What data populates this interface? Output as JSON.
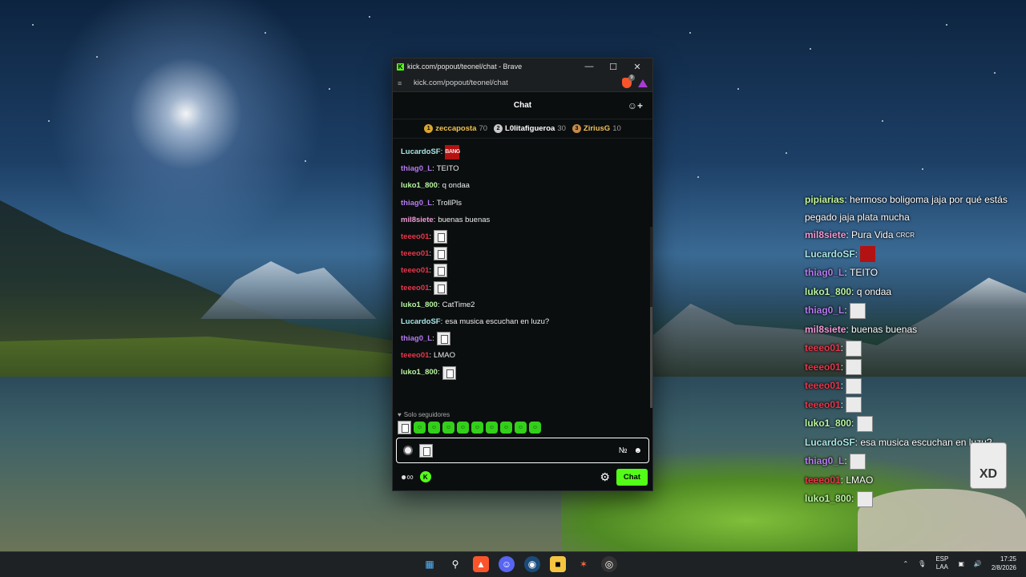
{
  "browser": {
    "title": "kick.com/popout/teonel/chat - Brave",
    "url": "kick.com/popout/teonel/chat",
    "logo_letter": "K",
    "shields_count": "9"
  },
  "chat": {
    "header": "Chat",
    "leaderboard": [
      {
        "rank": "1",
        "name": "zeccaposta",
        "count": "70",
        "color": "#f2c14e",
        "medal": "#d9a62e"
      },
      {
        "rank": "2",
        "name": "L0litafigueroa",
        "count": "30",
        "color": "#ffffff",
        "medal": "#c9c9c9"
      },
      {
        "rank": "3",
        "name": "ZiriusG",
        "count": "10",
        "color": "#f0c05a",
        "medal": "#c68a4a"
      }
    ],
    "messages": [
      {
        "user": "LucardoSF",
        "color": "#a8e6e6",
        "text": "",
        "emote": "BANG"
      },
      {
        "user": "thiag0_L",
        "color": "#b57bf0",
        "text": "TEITO",
        "emote": ""
      },
      {
        "user": "luko1_800",
        "color": "#b8f5a0",
        "text": "q ondaa",
        "emote": ""
      },
      {
        "user": "thiag0_L",
        "color": "#b57bf0",
        "text": "TrollPls",
        "emote": ""
      },
      {
        "user": "mil8siete",
        "color": "#f29ad8",
        "text": "buenas buenas",
        "emote": ""
      },
      {
        "user": "teeeo01",
        "color": "#e8374a",
        "text": "",
        "emote": "box"
      },
      {
        "user": "teeeo01",
        "color": "#e8374a",
        "text": "",
        "emote": "box"
      },
      {
        "user": "teeeo01",
        "color": "#e8374a",
        "text": "",
        "emote": "box"
      },
      {
        "user": "teeeo01",
        "color": "#e8374a",
        "text": "",
        "emote": "box"
      },
      {
        "user": "luko1_800",
        "color": "#b8f5a0",
        "text": "CatTime2",
        "emote": ""
      },
      {
        "user": "LucardoSF",
        "color": "#a8e6e6",
        "text": "esa musica escuchan en luzu?",
        "emote": ""
      },
      {
        "user": "thiag0_L",
        "color": "#b57bf0",
        "text": "",
        "emote": "box"
      },
      {
        "user": "teeeo01",
        "color": "#e8374a",
        "text": "LMAO",
        "emote": ""
      },
      {
        "user": "luko1_800",
        "color": "#b8f5a0",
        "text": "",
        "emote": "box"
      }
    ],
    "followers_only": "Solo seguidores",
    "input_placeholder": "",
    "chat_button": "Chat",
    "accent": "#53fc18"
  },
  "overlay": {
    "messages": [
      {
        "user": "pipiarias",
        "color": "#c3f59a",
        "text": "hermoso boligoma jaja por qué estás pegado jaja plata mucha",
        "emote": ""
      },
      {
        "user": "mil8siete",
        "color": "#f29ad8",
        "text": "Pura Vida",
        "emote": "CRCR"
      },
      {
        "user": "LucardoSF",
        "color": "#a8e6e6",
        "text": "",
        "emote": "BANG"
      },
      {
        "user": "thiag0_L",
        "color": "#b57bf0",
        "text": "TEITO",
        "emote": ""
      },
      {
        "user": "luko1_800",
        "color": "#b8f5a0",
        "text": "q ondaa",
        "emote": ""
      },
      {
        "user": "thiag0_L",
        "color": "#b57bf0",
        "text": "",
        "emote": "dance"
      },
      {
        "user": "mil8siete",
        "color": "#f29ad8",
        "text": "buenas buenas",
        "emote": ""
      },
      {
        "user": "teeeo01",
        "color": "#e8374a",
        "text": "",
        "emote": "box"
      },
      {
        "user": "teeeo01",
        "color": "#e8374a",
        "text": "",
        "emote": "box"
      },
      {
        "user": "teeeo01",
        "color": "#e8374a",
        "text": "",
        "emote": "box"
      },
      {
        "user": "teeeo01",
        "color": "#e8374a",
        "text": "",
        "emote": "box"
      },
      {
        "user": "luko1_800",
        "color": "#b8f5a0",
        "text": "",
        "emote": "cat"
      },
      {
        "user": "LucardoSF",
        "color": "#a8e6e6",
        "text": "esa musica escuchan en luzu?",
        "emote": ""
      },
      {
        "user": "thiag0_L",
        "color": "#b57bf0",
        "text": "",
        "emote": "box"
      },
      {
        "user": "teeeo01",
        "color": "#e8374a",
        "text": "LMAO",
        "emote": ""
      },
      {
        "user": "luko1_800",
        "color": "#b8f5a0",
        "text": "",
        "emote": "box"
      }
    ],
    "big_emote_text": "XD"
  },
  "taskbar": {
    "apps": [
      "windows-start",
      "search",
      "brave",
      "discord",
      "steam",
      "file-explorer",
      "app-sun",
      "obs"
    ],
    "language_top": "ESP",
    "language_bottom": "LAA",
    "time": "17:25",
    "date": "2/8/2026"
  }
}
